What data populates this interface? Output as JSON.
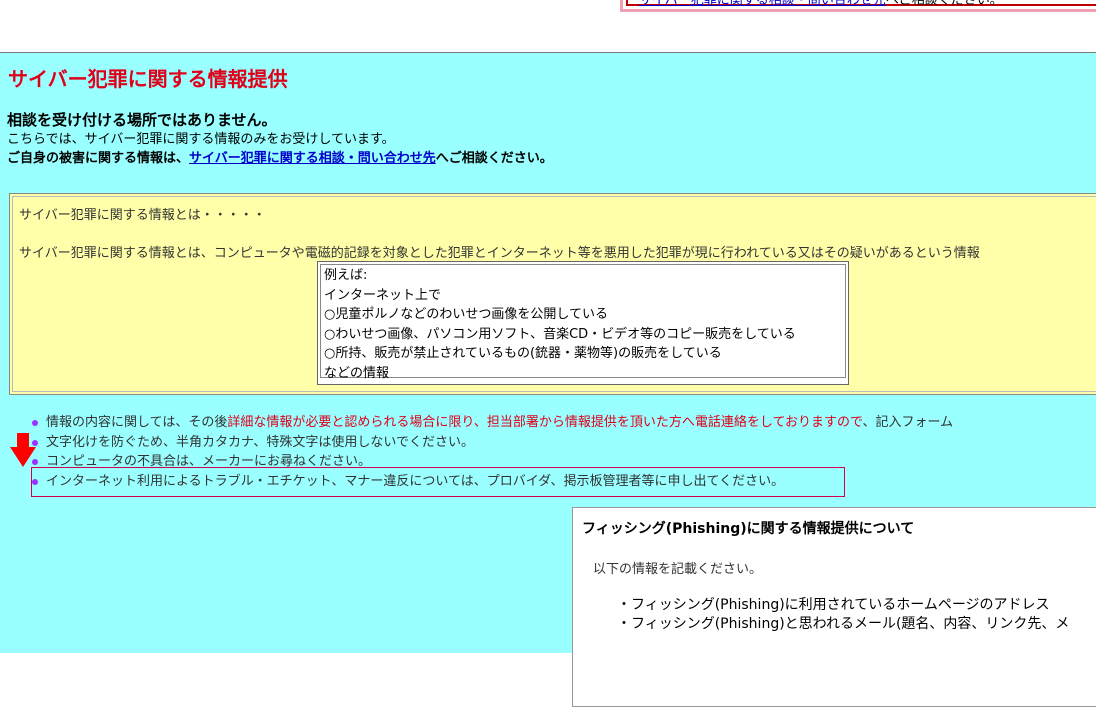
{
  "top_box": {
    "cut_link_text": "サイバー犯罪に関する相談・問い合わせ先",
    "cut_text": "へご相談ください。"
  },
  "title": "サイバー犯罪に関する情報提供",
  "notice": {
    "line1": "相談を受け付ける場所ではありません。",
    "line2": "こちらでは、サイバー犯罪に関する情報のみをお受けしています。",
    "line3_before": "ご自身の被害に関する情報は、",
    "line3_link": "サイバー犯罪に関する相談・問い合わせ先",
    "line3_after": "へご相談ください。"
  },
  "definition": {
    "heading": "サイバー犯罪に関する情報とは・・・・・",
    "text": "サイバー犯罪に関する情報とは、コンピュータや電磁的記録を対象とした犯罪とインターネット等を悪用した犯罪が現に行われている又はその疑いがあるという情報",
    "examples": [
      "例えば:",
      "インターネット上で",
      "○児童ポルノなどのわいせつ画像を公開している",
      "○わいせつ画像、パソコン用ソフト、音楽CD・ビデオ等のコピー販売をしている",
      "○所持、販売が禁止されているもの(銃器・薬物等)の販売をしている",
      "などの情報"
    ]
  },
  "bullets": {
    "item1_before": "情報の内容に関しては、その後",
    "item1_red": "詳細な情報が必要と認められる場合に限り、担当部署から情報提供を頂いた方へ電話連絡をしておりますので",
    "item1_after": "、記入フォーム",
    "item2": "文字化けを防ぐため、半角カタカナ、特殊文字は使用しないでください。",
    "item3": "コンピュータの不具合は、メーカーにお尋ねください。",
    "item4": "インターネット利用によるトラブル・エチケット、マナー違反については、プロバイダ、掲示板管理者等に申し出てください。"
  },
  "phishing": {
    "title": "フィッシング(Phishing)に関する情報提供について",
    "subtitle": "以下の情報を記載ください。",
    "items": [
      "・フィッシング(Phishing)に利用されているホームページのアドレス",
      "・フィッシング(Phishing)と思われるメール(題名、内容、リンク先、メ"
    ]
  },
  "colors": {
    "background": "#99ffff",
    "title_red": "#e0001a",
    "highlight_border": "#d0004a",
    "arrow": "#ff0000",
    "yellow_panel": "#ffffaa"
  }
}
